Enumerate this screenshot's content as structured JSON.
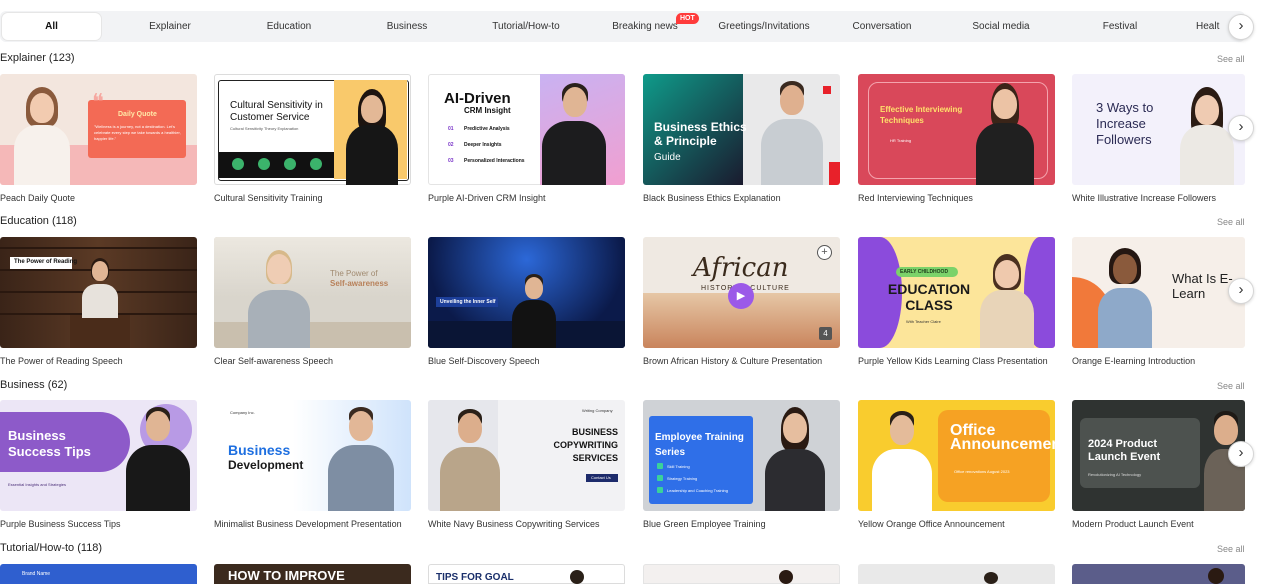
{
  "tabs": [
    {
      "label": "All",
      "active": true
    },
    {
      "label": "Explainer"
    },
    {
      "label": "Education"
    },
    {
      "label": "Business"
    },
    {
      "label": "Tutorial/How-to"
    },
    {
      "label": "Breaking news",
      "badge": "HOT"
    },
    {
      "label": "Greetings/Invitations"
    },
    {
      "label": "Conversation"
    },
    {
      "label": "Social media"
    },
    {
      "label": "Festival"
    },
    {
      "label": "Healt"
    }
  ],
  "see_all": "See all",
  "sections": [
    {
      "title": "Explainer (123)",
      "cards": [
        {
          "caption": "Peach Daily Quote",
          "text1": "Daily Quote",
          "text2": "\"Wellness is a journey, not a destination. Let's celebrate every step we take towards a healthier, happier life.\""
        },
        {
          "caption": "Cultural Sensitivity Training",
          "text1": "Cultural Sensitivity in Customer Service",
          "text2": "Cultural Sensitivity Theory Explanation"
        },
        {
          "caption": "Purple AI-Driven CRM Insight",
          "text1": "AI-Driven",
          "text2": "CRM Insight",
          "items": [
            "Predictive Analysis",
            "Deeper Insights",
            "Personalized Interactions"
          ],
          "nums": [
            "01",
            "02",
            "03"
          ]
        },
        {
          "caption": "Black Business Ethics Explanation",
          "text1": "Business Ethics & Principle",
          "text2": "Guide"
        },
        {
          "caption": "Red Interviewing Techniques",
          "text1": "Effective Interviewing Techniques",
          "text2": "HR Training"
        },
        {
          "caption": "White Illustrative Increase Followers",
          "text1": "3 Ways to Increase Followers"
        }
      ]
    },
    {
      "title": "Education (118)",
      "cards": [
        {
          "caption": "The Power of Reading Speech",
          "text1": "The Power of Reading"
        },
        {
          "caption": "Clear Self-awareness Speech",
          "text1": "The Power of",
          "text2": "Self-awareness"
        },
        {
          "caption": "Blue Self-Discovery Speech",
          "text1": "Unveiling the Inner Self"
        },
        {
          "caption": "Brown African History & Culture Presentation",
          "text1": "African",
          "text2": "HISTORY & CULTURE",
          "count": "4"
        },
        {
          "caption": "Purple Yellow Kids Learning Class Presentation",
          "text1": "EARLY CHILDHOOD",
          "text2": "EDUCATION CLASS",
          "text3": "With Teacher Claire"
        },
        {
          "caption": "Orange E-learning Introduction",
          "text1": "What Is E-Learn"
        }
      ]
    },
    {
      "title": "Business (62)",
      "cards": [
        {
          "caption": "Purple Business Success Tips",
          "text1": "Business Success Tips",
          "text2": "Essential Insights and Strategies"
        },
        {
          "caption": "Minimalist Business Development Presentation",
          "text1": "Business",
          "text2": "Development",
          "text3": "Company Inc."
        },
        {
          "caption": "White Navy Business Copywriting Services",
          "text1": "BUSINESS COPYWRITING SERVICES",
          "text2": "Contact Us",
          "text3": "Writing Company"
        },
        {
          "caption": "Blue Green Employee Training",
          "text1": "Employee Training Series",
          "items": [
            "Skill Training",
            "Strategy Training",
            "Leadership and Coaching Training"
          ]
        },
        {
          "caption": "Yellow Orange Office Announcement",
          "text1": "Office Announcement",
          "text2": "Office renovations August 2023"
        },
        {
          "caption": "Modern Product Launch Event",
          "text1": "2024 Product Launch Event",
          "text2": "Revolutionizing AI Technology"
        }
      ]
    },
    {
      "title": "Tutorial/How-to (118)",
      "cards": [
        {
          "caption": "",
          "text1": "Brand Name"
        },
        {
          "caption": "",
          "text1": "HOW TO IMPROVE"
        },
        {
          "caption": "",
          "text1": "TIPS FOR GOAL"
        },
        {
          "caption": ""
        },
        {
          "caption": ""
        },
        {
          "caption": ""
        }
      ]
    }
  ],
  "colors": {
    "accent": "#ff3b3b",
    "tab_bg": "#f2f3f5"
  },
  "icons": {
    "next": "chevron-right-icon"
  }
}
